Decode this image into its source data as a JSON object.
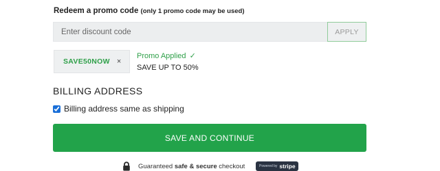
{
  "promo": {
    "heading": "Redeem a promo code",
    "note": "(only 1 promo code may be used)",
    "input_value": "",
    "input_placeholder": "Enter discount code",
    "apply_label": "APPLY",
    "applied_code": "SAVE50NOW",
    "remove_symbol": "×",
    "status": "Promo Applied",
    "status_check": "✓",
    "detail": "SAVE UP TO 50%"
  },
  "billing": {
    "heading": "BILLING ADDRESS",
    "same_as_shipping_label": "Billing address same as shipping",
    "same_as_shipping_checked": true
  },
  "actions": {
    "save_label": "SAVE AND CONTINUE"
  },
  "footer": {
    "secure_prefix": "Guaranteed",
    "secure_bold": "safe & secure",
    "secure_suffix": "checkout",
    "powered_by": "Powered by",
    "stripe": "stripe"
  },
  "icons": {
    "lock": "lock-icon",
    "check": "check-icon",
    "remove": "close-icon"
  },
  "colors": {
    "accent_green": "#22a34a",
    "applied_green": "#2fa049",
    "stripe_badge": "#2a3342"
  }
}
